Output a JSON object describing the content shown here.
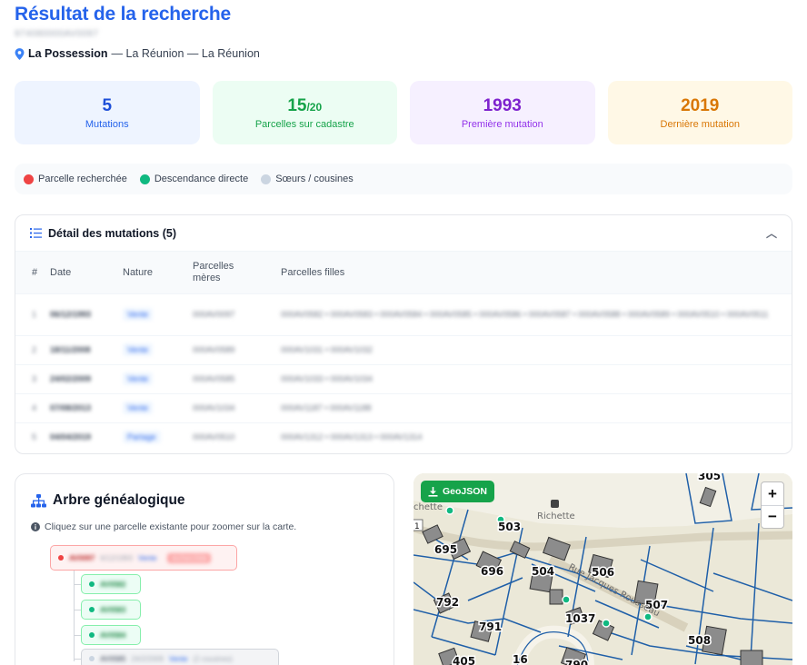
{
  "header": {
    "title": "Résultat de la recherche",
    "parcel_id": "974080000AV0097",
    "commune": "La Possession",
    "location_rest": "— La Réunion — La Réunion"
  },
  "stats": [
    {
      "value": "5",
      "suffix": "",
      "label": "Mutations"
    },
    {
      "value": "15",
      "suffix": "/20",
      "label": "Parcelles sur cadastre"
    },
    {
      "value": "1993",
      "suffix": "",
      "label": "Première mutation"
    },
    {
      "value": "2019",
      "suffix": "",
      "label": "Dernière mutation"
    }
  ],
  "legend": [
    {
      "label": "Parcelle recherchée",
      "color": "#ef4444"
    },
    {
      "label": "Descendance directe",
      "color": "#10b981"
    },
    {
      "label": "Sœurs / cousines",
      "color": "#cbd5e1"
    }
  ],
  "mutations": {
    "title": "Détail des mutations (5)",
    "columns": [
      "#",
      "Date",
      "Nature",
      "Parcelles mères",
      "Parcelles filles"
    ],
    "rows": [
      {
        "num": "1",
        "date": "06/12/1993",
        "nature": "Vente",
        "meres": "000AV0097",
        "filles": "000AV0582 • 000AV0583 • 000AV0584 • 000AV0585 • 000AV0586 • 000AV0587 • 000AV0588 • 000AV0589 • 000AV0510 • 000AV0511"
      },
      {
        "num": "2",
        "date": "18/11/2008",
        "nature": "Vente",
        "meres": "000AV0589",
        "filles": "000AV1031 • 000AV1032"
      },
      {
        "num": "3",
        "date": "24/02/2009",
        "nature": "Vente",
        "meres": "000AV0585",
        "filles": "000AV1033 • 000AV1034"
      },
      {
        "num": "4",
        "date": "07/08/2013",
        "nature": "Vente",
        "meres": "000AV1034",
        "filles": "000AV1187 • 000AV1188"
      },
      {
        "num": "5",
        "date": "04/04/2019",
        "nature": "Partage",
        "meres": "000AV0510",
        "filles": "000AV1312 • 000AV1313 • 000AV1314"
      }
    ]
  },
  "tree": {
    "title": "Arbre généalogique",
    "hint": "Cliquez sur une parcelle existante pour zoomer sur la carte.",
    "root": {
      "id": "AV0097",
      "date": "6/12/1993",
      "nature": "Vente",
      "badge": "recherchée"
    },
    "children": [
      "AV0582",
      "AV0583",
      "AV0584"
    ],
    "sibling": {
      "id": "AV0585",
      "date": "24/2/2009",
      "nature": "Vente",
      "extra": "(2 cousines)"
    }
  },
  "map": {
    "geojson_label": "GeoJSON",
    "zoom_in": "+",
    "zoom_out": "−",
    "street_label": "Rue Jacques Rousseau",
    "place_label": "Richette",
    "place_label_left": "chette",
    "road_number": "1",
    "parcel_numbers": [
      "305",
      "503",
      "695",
      "696",
      "504",
      "506",
      "792",
      "507",
      "1037",
      "791",
      "508",
      "405",
      "16",
      "790"
    ]
  }
}
